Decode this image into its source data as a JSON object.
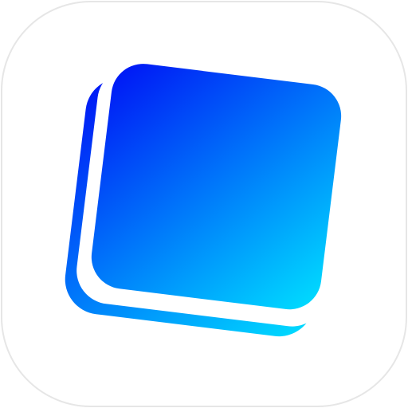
{
  "app_icon": {
    "icon_name": "layered-square-app-icon",
    "colors": {
      "background": "#ffffff",
      "tile_border": "#e6e6e6",
      "gradient_start": "#0012f5",
      "gradient_end": "#00e0ff",
      "separator": "#ffffff"
    }
  }
}
